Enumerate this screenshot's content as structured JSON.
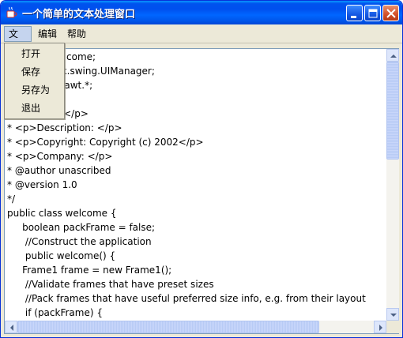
{
  "window": {
    "title": "一个简单的文本处理窗口",
    "icon": "java-coffee-cup-icon"
  },
  "menubar": {
    "items": [
      "文件",
      "编辑",
      "帮助"
    ]
  },
  "file_menu": {
    "items": [
      "打开",
      "保存",
      "另存为",
      "退出"
    ]
  },
  "editor": {
    "lines": [
      "package welcome;",
      "import javax.swing.UIManager;",
      "import java.awt.*;",
      "",
      "* <p>Title: </p>",
      "* <p>Description: </p>",
      "* <p>Copyright: Copyright (c) 2002</p>",
      "* <p>Company: </p>",
      "* @author unascribed",
      "* @version 1.0",
      "*/",
      "public class welcome {",
      "     boolean packFrame = false;",
      "      //Construct the application",
      "      public welcome() {",
      "     Frame1 frame = new Frame1();",
      "      //Validate frames that have preset sizes",
      "      //Pack frames that have useful preferred size info, e.g. from their layout",
      "      if (packFrame) {"
    ]
  },
  "colors": {
    "titlebar": "#0055ea",
    "window_bg": "#ece9d8",
    "scroll_thumb": "#c8d6fa"
  }
}
